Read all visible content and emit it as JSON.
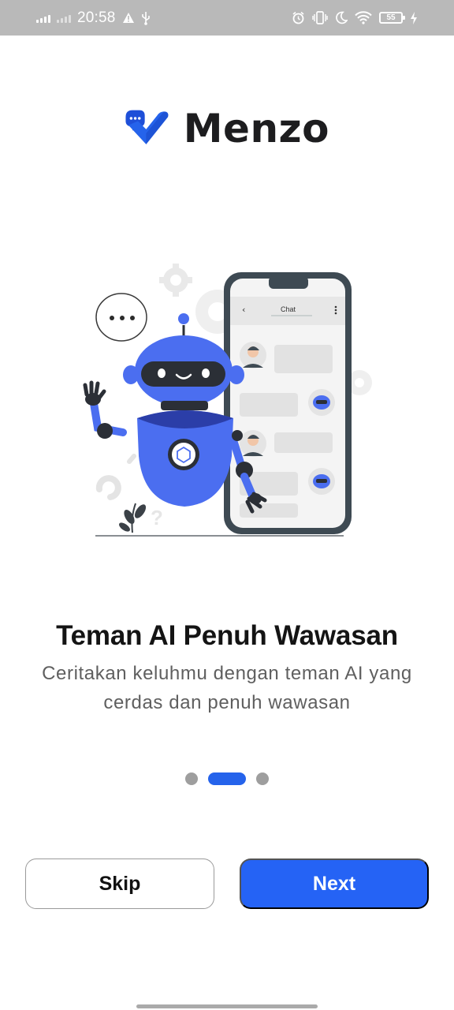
{
  "status_bar": {
    "time": "20:58",
    "battery": "55",
    "icons": [
      "signal-icon",
      "signal-icon",
      "warning-icon",
      "usb-icon",
      "alarm-icon",
      "vibrate-icon",
      "moon-icon",
      "wifi-icon",
      "battery-icon",
      "charging-icon"
    ]
  },
  "brand": {
    "name": "Menzo",
    "accent": "#2563eb"
  },
  "illustration": {
    "phone_header": "Chat",
    "icons": [
      "robot-illustration",
      "chat-bubble-icon",
      "gear-icon",
      "back-arrow-icon",
      "more-vert-icon",
      "avatar-icon",
      "bot-avatar-icon",
      "plant-icon",
      "question-mark-icon"
    ]
  },
  "onboarding": {
    "title": "Teman AI Penuh Wawasan",
    "subtitle": "Ceritakan keluhmu dengan teman AI yang cerdas dan penuh wawasan",
    "current_page": 2,
    "total_pages": 3
  },
  "actions": {
    "skip_label": "Skip",
    "next_label": "Next"
  },
  "colors": {
    "primary": "#2563f5",
    "indicator_inactive": "#9e9e9e",
    "text_primary": "#141414",
    "text_secondary": "#5f5f5f"
  }
}
